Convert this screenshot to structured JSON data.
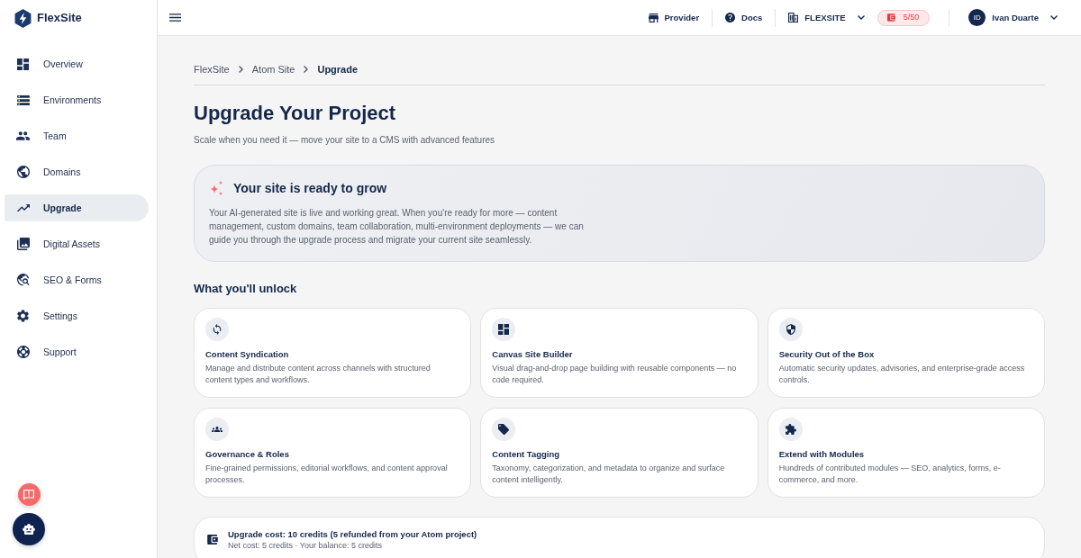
{
  "brand": {
    "name": "FlexSite"
  },
  "sidebar": {
    "items": [
      {
        "label": "Overview",
        "selected": false
      },
      {
        "label": "Environments",
        "selected": false
      },
      {
        "label": "Team",
        "selected": false
      },
      {
        "label": "Domains",
        "selected": false
      },
      {
        "label": "Upgrade",
        "selected": true
      },
      {
        "label": "Digital Assets",
        "selected": false
      },
      {
        "label": "SEO & Forms",
        "selected": false
      },
      {
        "label": "Settings",
        "selected": false
      },
      {
        "label": "Support",
        "selected": false
      }
    ]
  },
  "topbar": {
    "links": [
      {
        "label": "Provider"
      },
      {
        "label": "Docs"
      }
    ],
    "workspace": {
      "label": "FLEXSITE"
    },
    "credits": {
      "label": "5/50"
    },
    "user": {
      "initials": "ID",
      "name": "Ivan Duarte"
    }
  },
  "breadcrumb": [
    {
      "label": "FlexSite",
      "current": false
    },
    {
      "label": "Atom Site",
      "current": false
    },
    {
      "label": "Upgrade",
      "current": true
    }
  ],
  "page": {
    "title": "Upgrade Your Project",
    "subtitle": "Scale when you need it — move your site to a CMS with advanced features"
  },
  "banner": {
    "title": "Your site is ready to grow",
    "body": "Your AI-generated site is live and working great. When you're ready for more — content management, custom domains, team collaboration, multi-environment deployments — we can guide you through the upgrade process and migrate your current site seamlessly."
  },
  "unlock": {
    "heading": "What you'll unlock",
    "features": [
      {
        "title": "Content Syndication",
        "description": "Manage and distribute content across channels with structured content types and workflows."
      },
      {
        "title": "Canvas Site Builder",
        "description": "Visual drag-and-drop page building with reusable components — no code required."
      },
      {
        "title": "Security Out of the Box",
        "description": "Automatic security updates, advisories, and enterprise-grade access controls."
      },
      {
        "title": "Governance & Roles",
        "description": "Fine-grained permissions, editorial workflows, and content approval processes."
      },
      {
        "title": "Content Tagging",
        "description": "Taxonomy, categorization, and metadata to organize and surface content intelligently."
      },
      {
        "title": "Extend with Modules",
        "description": "Hundreds of contributed modules — SEO, analytics, forms, e-commerce, and more."
      }
    ]
  },
  "cost": {
    "title": "Upgrade cost: 10 credits (5 refunded from your Atom project)",
    "detail": "Net cost: 5 credits · Your balance: 5 credits"
  }
}
